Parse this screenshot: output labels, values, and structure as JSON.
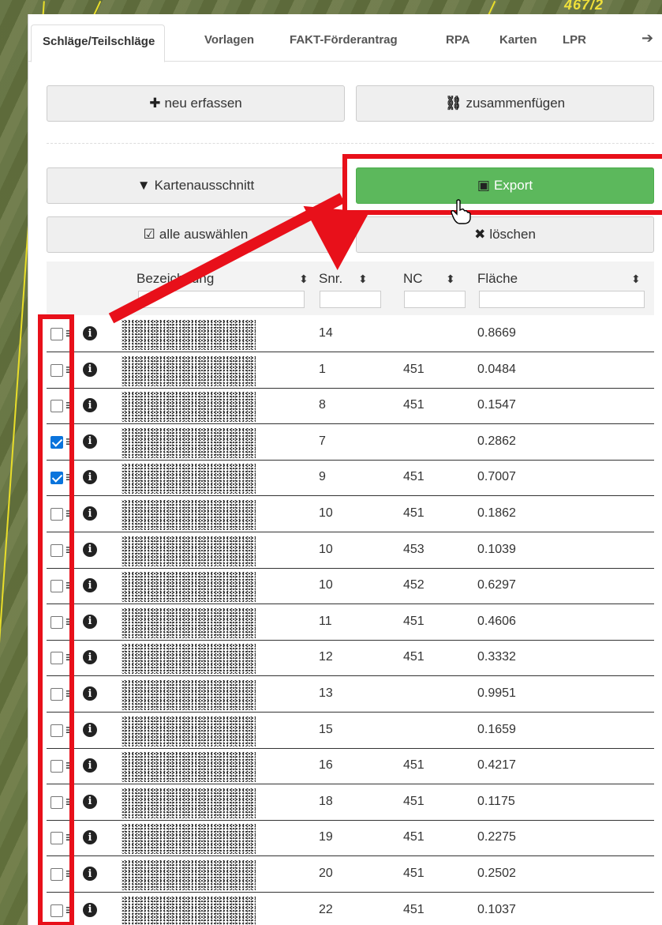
{
  "map": {
    "label": "467/2"
  },
  "tabs": [
    {
      "label": "Schläge/Teilschläge"
    },
    {
      "label": "Vorlagen"
    },
    {
      "label": "FAKT-Förderantrag"
    },
    {
      "label": "RPA"
    },
    {
      "label": "Karten"
    },
    {
      "label": "LPR"
    }
  ],
  "tab_arrow": "➔",
  "buttons": {
    "new": {
      "icon": "plus-icon",
      "glyph": "✚",
      "label": "neu erfassen"
    },
    "merge": {
      "icon": "merge-icon",
      "glyph": "⛓",
      "label": "zusammenfügen"
    },
    "map_section": {
      "icon": "filter-icon",
      "glyph": "▼",
      "label": "Kartenausschnitt"
    },
    "export": {
      "icon": "export-icon",
      "glyph": "▣",
      "label": "Export",
      "color": "#5cb85c"
    },
    "select_all": {
      "icon": "check-square-icon",
      "glyph": "☑",
      "label": "alle auswählen"
    },
    "delete": {
      "icon": "times-icon",
      "glyph": "✖",
      "label": "löschen"
    }
  },
  "table": {
    "columns": [
      {
        "label": "Bezeichnung",
        "sort": "⬍"
      },
      {
        "label": "Snr.",
        "sort": "⬍"
      },
      {
        "label": "NC",
        "sort": "⬍"
      },
      {
        "label": "Fläche",
        "sort": "⬍"
      }
    ],
    "rows": [
      {
        "checked": false,
        "snr": "14",
        "nc": "",
        "flaeche": "0.8669"
      },
      {
        "checked": false,
        "snr": "1",
        "nc": "451",
        "flaeche": "0.0484"
      },
      {
        "checked": false,
        "snr": "8",
        "nc": "451",
        "flaeche": "0.1547"
      },
      {
        "checked": true,
        "snr": "7",
        "nc": "",
        "flaeche": "0.2862"
      },
      {
        "checked": true,
        "snr": "9",
        "nc": "451",
        "flaeche": "0.7007"
      },
      {
        "checked": false,
        "snr": "10",
        "nc": "451",
        "flaeche": "0.1862"
      },
      {
        "checked": false,
        "snr": "10",
        "nc": "453",
        "flaeche": "0.1039"
      },
      {
        "checked": false,
        "snr": "10",
        "nc": "452",
        "flaeche": "0.6297"
      },
      {
        "checked": false,
        "snr": "11",
        "nc": "451",
        "flaeche": "0.4606"
      },
      {
        "checked": false,
        "snr": "12",
        "nc": "451",
        "flaeche": "0.3332"
      },
      {
        "checked": false,
        "snr": "13",
        "nc": "",
        "flaeche": "0.9951"
      },
      {
        "checked": false,
        "snr": "15",
        "nc": "",
        "flaeche": "0.1659"
      },
      {
        "checked": false,
        "snr": "16",
        "nc": "451",
        "flaeche": "0.4217"
      },
      {
        "checked": false,
        "snr": "18",
        "nc": "451",
        "flaeche": "0.1175"
      },
      {
        "checked": false,
        "snr": "19",
        "nc": "451",
        "flaeche": "0.2275"
      },
      {
        "checked": false,
        "snr": "20",
        "nc": "451",
        "flaeche": "0.2502"
      },
      {
        "checked": false,
        "snr": "22",
        "nc": "451",
        "flaeche": "0.1037"
      }
    ]
  },
  "annotation_color": "#e8101a"
}
